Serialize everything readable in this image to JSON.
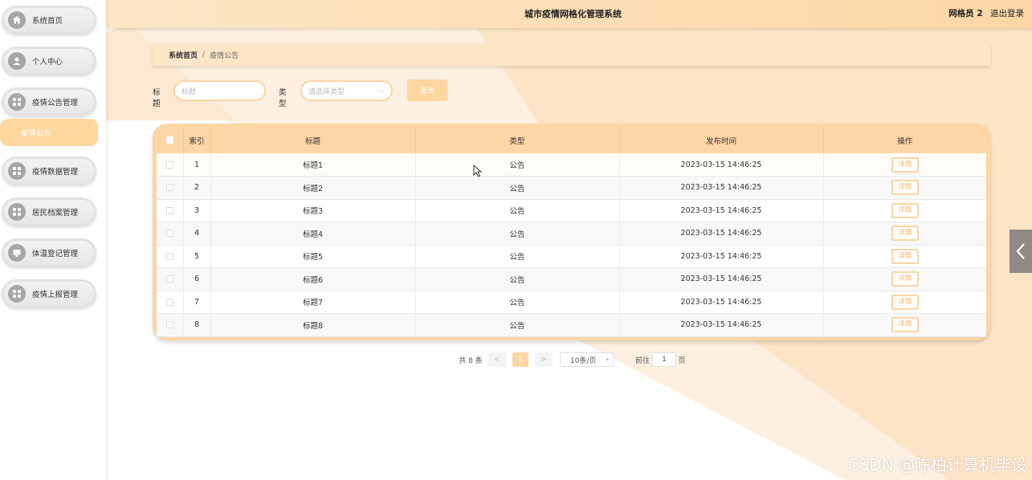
{
  "header": {
    "title": "城市疫情网格化管理系统",
    "user": "网格员 2",
    "logout": "退出登录"
  },
  "sidebar": {
    "items": [
      {
        "label": "系统首页",
        "icon": "home-icon"
      },
      {
        "label": "个人中心",
        "icon": "user-icon"
      },
      {
        "label": "疫情公告管理",
        "icon": "grid-icon"
      },
      {
        "label": "疫情数据管理",
        "icon": "grid-icon"
      },
      {
        "label": "居民档案管理",
        "icon": "grid-icon"
      },
      {
        "label": "体温登记管理",
        "icon": "monitor-icon"
      },
      {
        "label": "疫情上报管理",
        "icon": "grid-icon"
      }
    ],
    "sub_item": "疫情公告"
  },
  "breadcrumb": {
    "home": "系统首页",
    "separator": "/",
    "current": "疫情公告"
  },
  "search": {
    "title_label": "标题",
    "title_placeholder": "标题",
    "type_label": "类型",
    "type_placeholder": "请选择类型",
    "button": "查询"
  },
  "table": {
    "headers": [
      "索引",
      "标题",
      "类型",
      "发布时间",
      "操作"
    ],
    "detail_button": "详情",
    "rows": [
      {
        "index": "1",
        "title": "标题1",
        "type": "公告",
        "time": "2023-03-15 14:46:25"
      },
      {
        "index": "2",
        "title": "标题2",
        "type": "公告",
        "time": "2023-03-15 14:46:25"
      },
      {
        "index": "3",
        "title": "标题3",
        "type": "公告",
        "time": "2023-03-15 14:46:25"
      },
      {
        "index": "4",
        "title": "标题4",
        "type": "公告",
        "time": "2023-03-15 14:46:25"
      },
      {
        "index": "5",
        "title": "标题5",
        "type": "公告",
        "time": "2023-03-15 14:46:25"
      },
      {
        "index": "6",
        "title": "标题6",
        "type": "公告",
        "time": "2023-03-15 14:46:25"
      },
      {
        "index": "7",
        "title": "标题7",
        "type": "公告",
        "time": "2023-03-15 14:46:25"
      },
      {
        "index": "8",
        "title": "标题8",
        "type": "公告",
        "time": "2023-03-15 14:46:25"
      }
    ]
  },
  "pagination": {
    "total": "共 8 条",
    "prev": "<",
    "current_page": "1",
    "next": ">",
    "page_size": "10条/页",
    "goto_label": "前往",
    "goto_value": "1",
    "page_suffix": "页"
  },
  "watermark": "CSDN @陈柏计算机毕设",
  "colors": {
    "accent": "#fcd6a4",
    "header": "#fde6c5",
    "active": "#fdd6a0"
  }
}
